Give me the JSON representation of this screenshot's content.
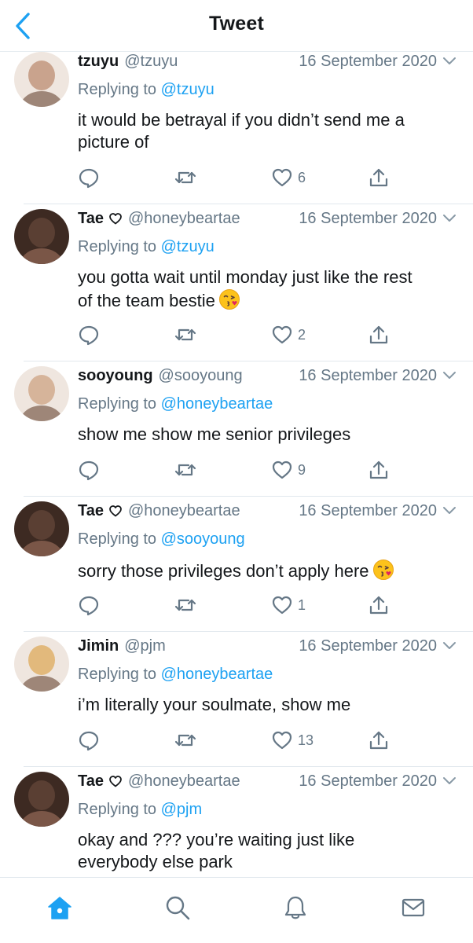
{
  "header": {
    "title": "Tweet"
  },
  "tweets": [
    {
      "name": "tzuyu",
      "handle": "@tzuyu",
      "heart_badge": false,
      "date": "16 September 2020",
      "reply_prefix": "Replying to",
      "reply_to": "@tzuyu",
      "lines": [
        "it would be betrayal if you didn’t send me a",
        "picture of"
      ],
      "emoji_line": null,
      "likes": "6",
      "avatar_color": "#c9a38d"
    },
    {
      "name": "Tae",
      "handle": "@honeybeartae",
      "heart_badge": true,
      "date": "16 September 2020",
      "reply_prefix": "Replying to",
      "reply_to": "@tzuyu",
      "lines": [
        "you gotta wait until monday just like the rest",
        "of the team bestie"
      ],
      "emoji_line": 1,
      "likes": "2",
      "avatar_color": "#5a3f33"
    },
    {
      "name": "sooyoung",
      "handle": "@sooyoung",
      "heart_badge": false,
      "date": "16 September 2020",
      "reply_prefix": "Replying to",
      "reply_to": "@honeybeartae",
      "lines": [
        "show me show me senior privileges"
      ],
      "emoji_line": null,
      "likes": "9",
      "avatar_color": "#d6b49a"
    },
    {
      "name": "Tae",
      "handle": "@honeybeartae",
      "heart_badge": true,
      "date": "16 September 2020",
      "reply_prefix": "Replying to",
      "reply_to": "@sooyoung",
      "lines": [
        "sorry those privileges don’t apply here"
      ],
      "emoji_line": 0,
      "likes": "1",
      "avatar_color": "#5a3f33"
    },
    {
      "name": "Jimin",
      "handle": "@pjm",
      "heart_badge": false,
      "date": "16 September 2020",
      "reply_prefix": "Replying to",
      "reply_to": "@honeybeartae",
      "lines": [
        "i’m literally your soulmate, show me"
      ],
      "emoji_line": null,
      "likes": "13",
      "avatar_color": "#e2b97c"
    },
    {
      "name": "Tae",
      "handle": "@honeybeartae",
      "heart_badge": true,
      "date": "16 September 2020",
      "reply_prefix": "Replying to",
      "reply_to": "@pjm",
      "lines": [
        "okay and ??? you’re waiting just like",
        "everybody else park"
      ],
      "emoji_line": null,
      "likes": "",
      "avatar_color": "#5a3f33"
    }
  ],
  "icons": {
    "back": "chevron-left-icon",
    "caret": "chevron-down-icon",
    "reply": "reply-icon",
    "retweet": "retweet-icon",
    "like": "heart-icon",
    "share": "share-icon",
    "home": "home-icon",
    "search": "search-icon",
    "notifications": "bell-icon",
    "messages": "mail-icon"
  },
  "colors": {
    "accent": "#1da1f2",
    "secondary": "#657786",
    "text": "#14171a",
    "divider": "#e1e8ed"
  }
}
